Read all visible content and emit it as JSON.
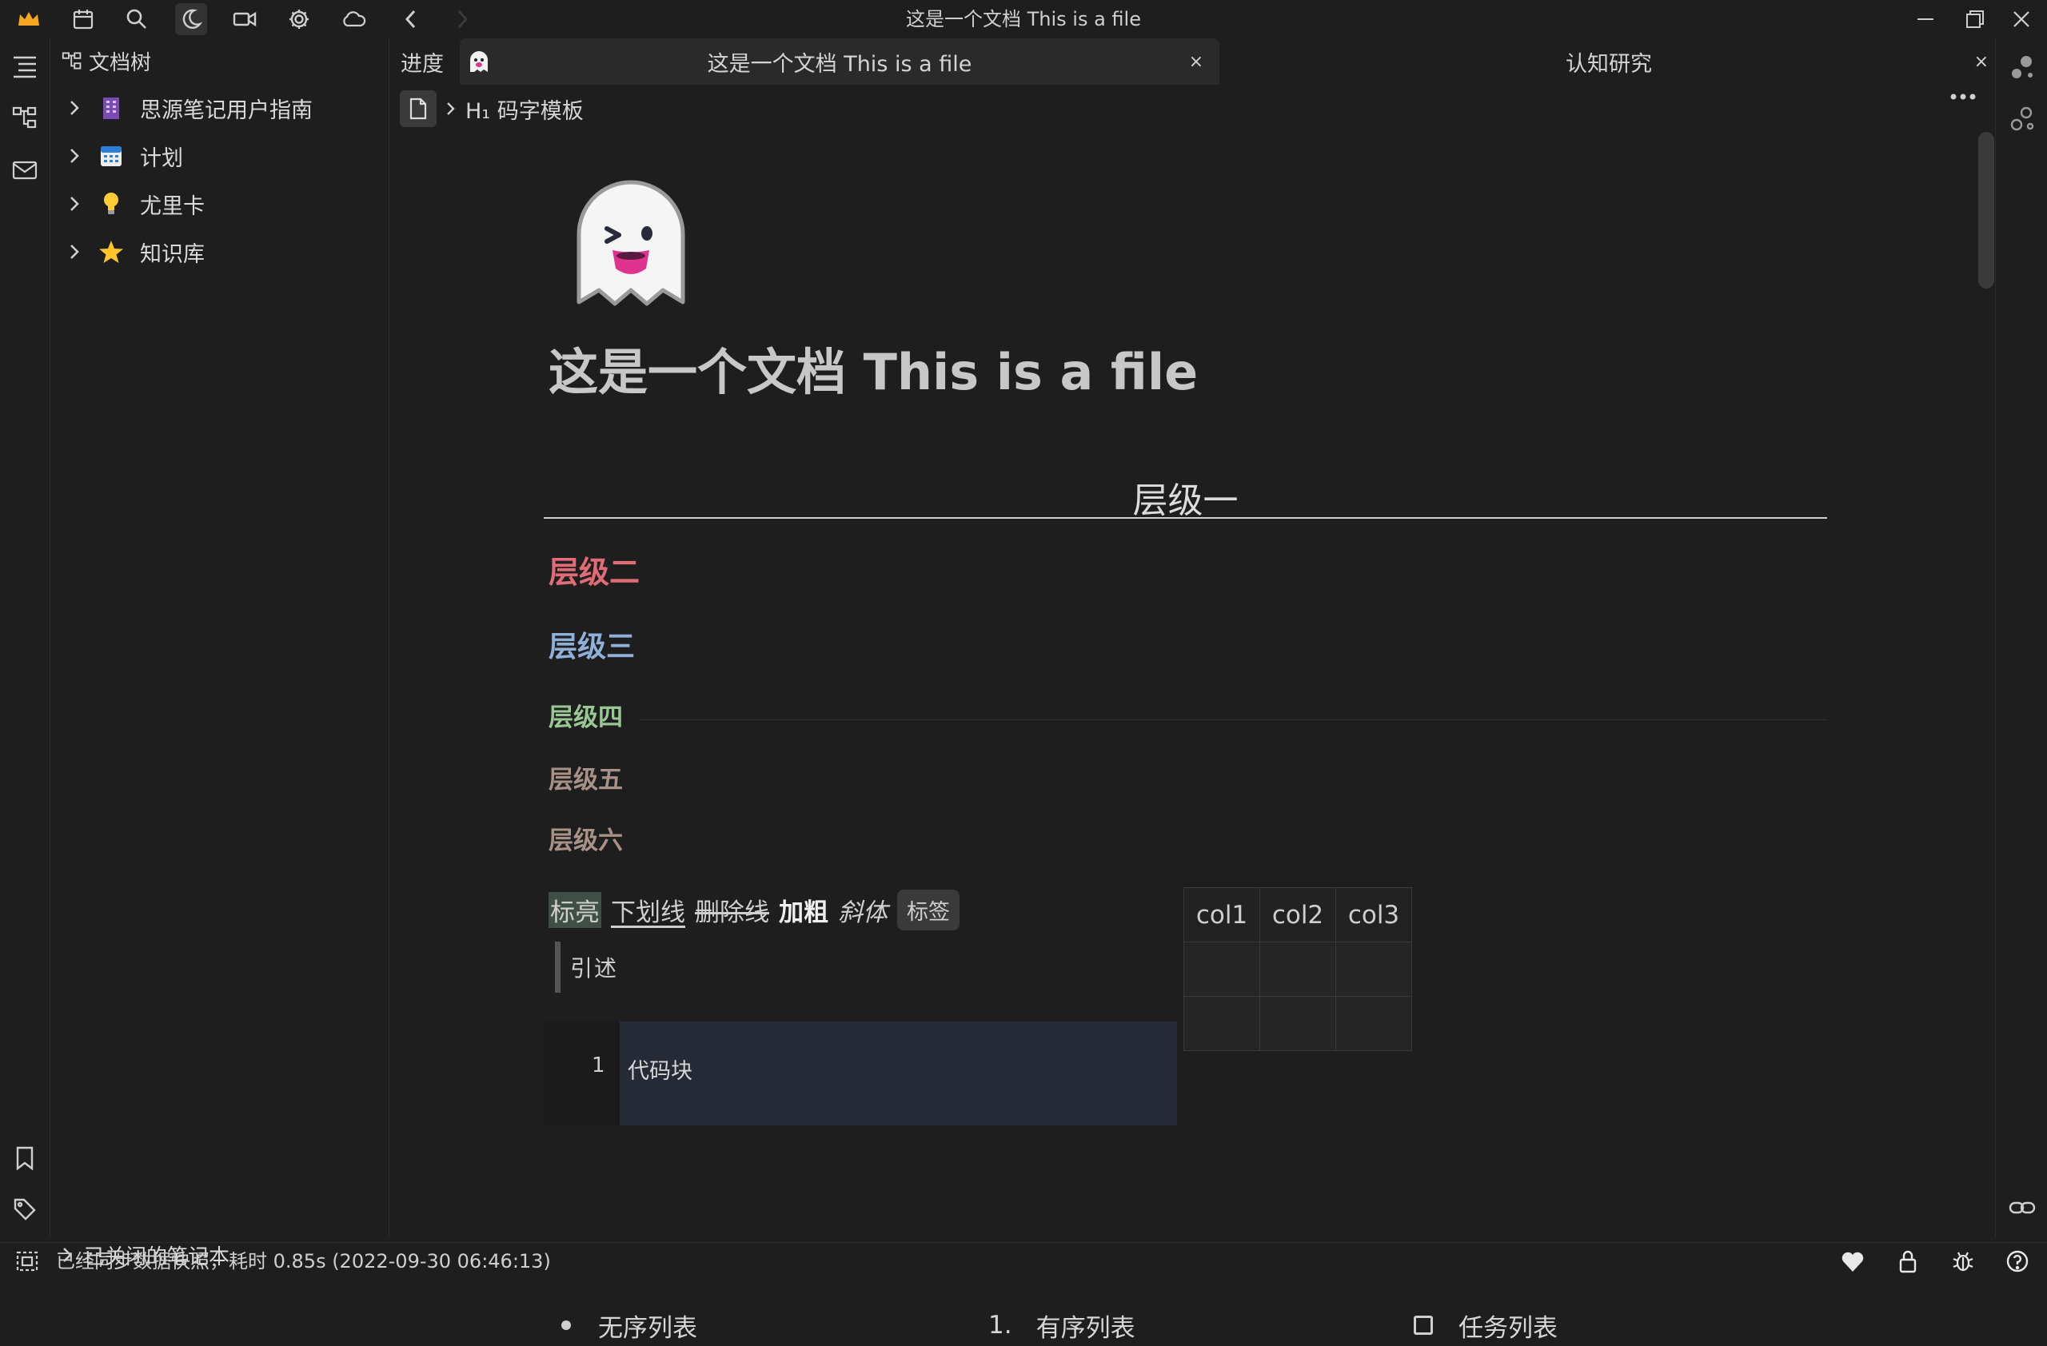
{
  "window": {
    "title": "这是一个文档 This is a file",
    "controls": [
      "minimize-icon",
      "restore-icon",
      "close-icon"
    ]
  },
  "toolbar": {
    "icons": [
      "crown-icon",
      "calendar-icon",
      "search-icon",
      "moon-icon",
      "video-icon",
      "gear-icon",
      "cloud-icon",
      "back-icon",
      "forward-icon"
    ],
    "crown_color": "#f5a623"
  },
  "sidebar": {
    "title": "文档树",
    "items": [
      {
        "label": "思源笔记用户指南",
        "icon": "building-icon"
      },
      {
        "label": "计划",
        "icon": "calendar-emoji-icon"
      },
      {
        "label": "尤里卡",
        "icon": "lightbulb-icon"
      },
      {
        "label": "知识库",
        "icon": "star-icon"
      }
    ],
    "closed_notebooks": "已关闭的笔记本"
  },
  "tabs": {
    "progress": "进度",
    "main": "这是一个文档 This is a file",
    "other": "认知研究",
    "close": "×"
  },
  "breadcrumb": {
    "heading": "H₁ 码字模板"
  },
  "document": {
    "title": "这是一个文档 This is a file",
    "h1": "层级一",
    "h2": "层级二",
    "h3": "层级三",
    "h4": "层级四",
    "h5": "层级五",
    "h6": "层级六",
    "inline": {
      "highlight": "标亮",
      "underline": "下划线",
      "strike": "删除线",
      "bold": "加粗",
      "italic": "斜体",
      "tag": "标签"
    },
    "quote": "引述",
    "code": {
      "line": "1",
      "text": "代码块"
    },
    "table": {
      "headers": [
        "col1",
        "col2",
        "col3"
      ]
    },
    "lists": {
      "unordered": "无序列表",
      "ordered_marker": "1.",
      "ordered": "有序列表",
      "task": "任务列表"
    },
    "colors": {
      "h2": "#e06c75",
      "h3": "#8fb0d8",
      "h4": "#99c794",
      "h5": "#a89187"
    }
  },
  "status": {
    "text": "已经同步数据快照，耗时 0.85s (2022-09-30 06:46:13)"
  }
}
